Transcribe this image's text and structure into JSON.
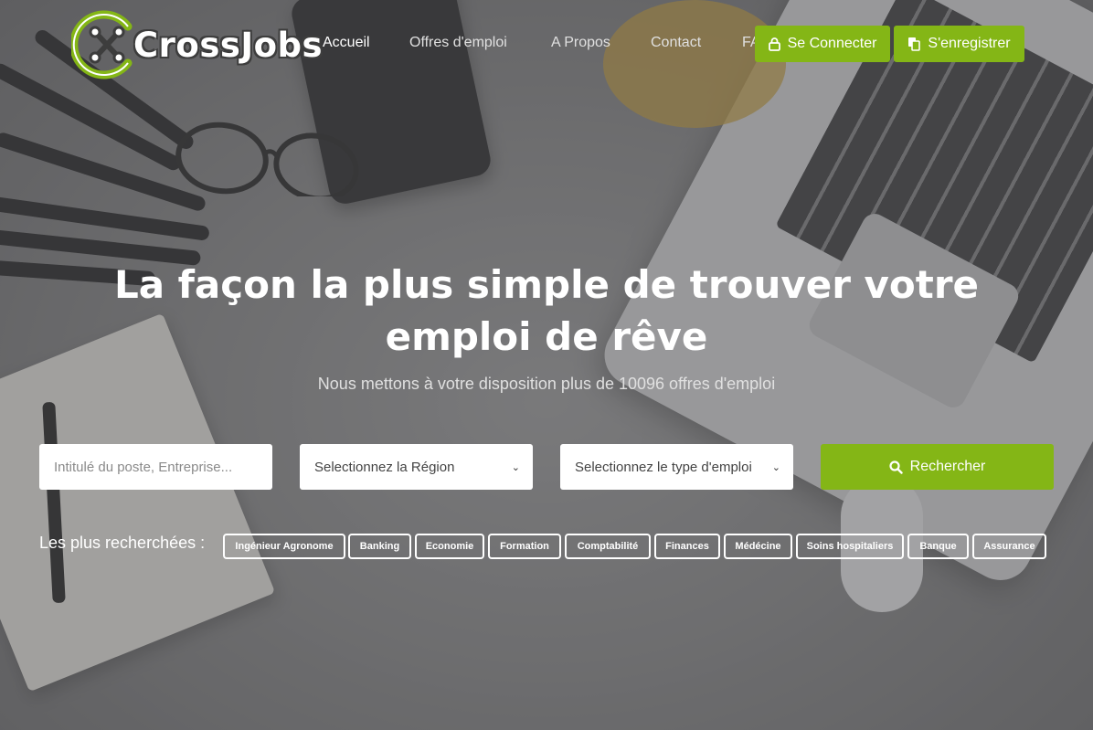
{
  "brand": {
    "name": "CrossJobs",
    "accent": "#84b616"
  },
  "nav": {
    "items": [
      "Accueil",
      "Offres d'emploi",
      "A Propos",
      "Contact",
      "FAQ"
    ]
  },
  "auth": {
    "login_label": "Se Connecter",
    "login_icon": "lock-icon",
    "register_label": "S'enregistrer",
    "register_icon": "copy-icon"
  },
  "hero": {
    "headline": "La façon la plus simple de trouver votre emploi de rêve",
    "subline": "Nous mettons à votre disposition plus de 10096 offres d'emploi"
  },
  "search": {
    "keyword_placeholder": "Intitulé du poste, Entreprise...",
    "region_value": "Selectionnez la Région",
    "type_value": "Selectionnez le type d'emploi",
    "button_label": "Rechercher",
    "button_icon": "search-icon"
  },
  "popular": {
    "label": "Les plus recherchées :",
    "tags": [
      "Ingénieur Agronome",
      "Banking",
      "Economie",
      "Formation",
      "Comptabilité",
      "Finances",
      "Médécine",
      "Soins hospitaliers",
      "Banque",
      "Assurance"
    ]
  }
}
